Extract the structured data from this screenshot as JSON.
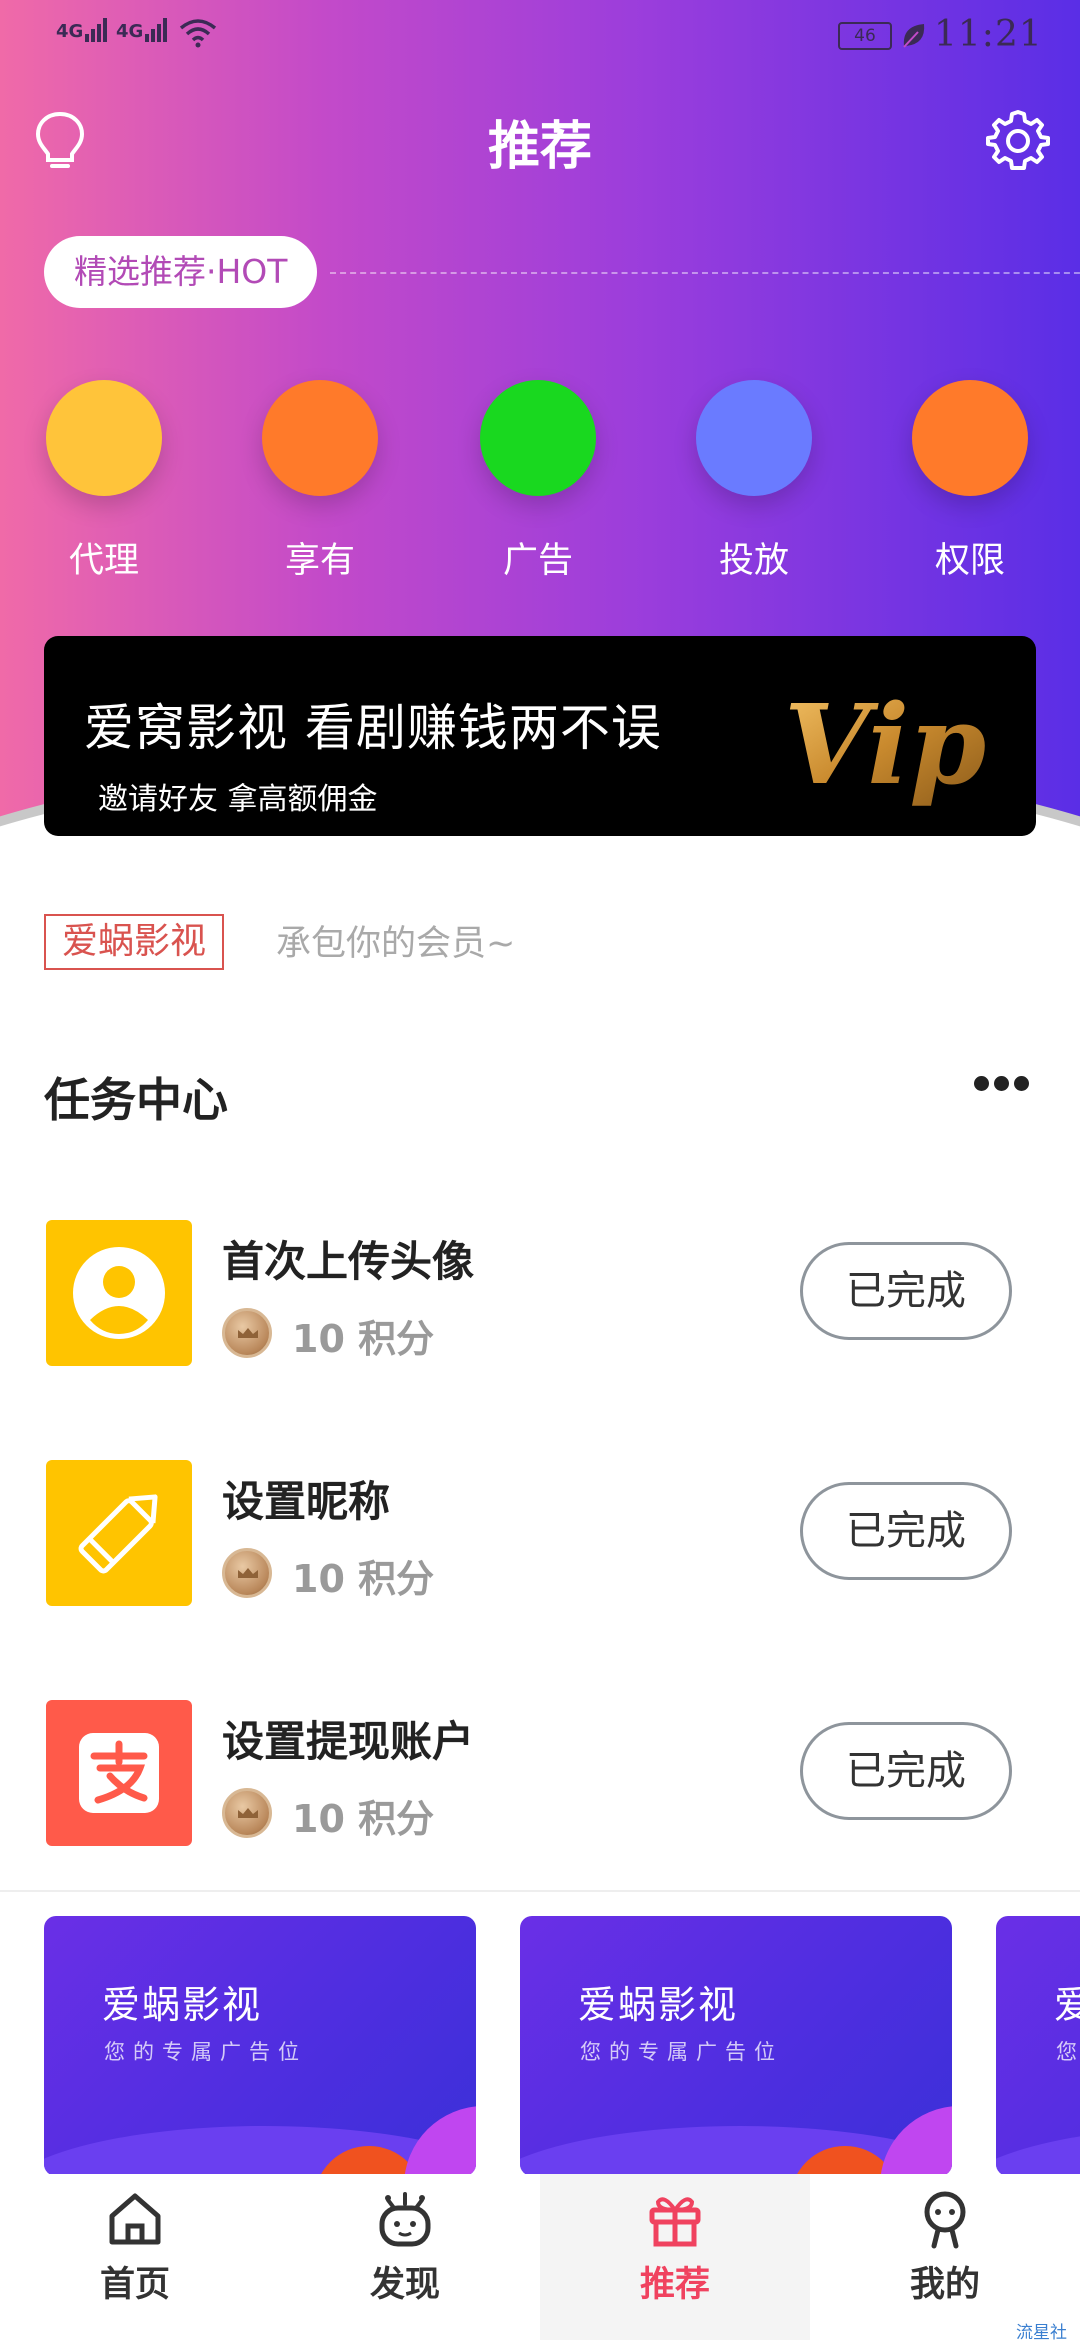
{
  "status_bar": {
    "signal1": "4G",
    "signal2": "4G",
    "battery": "46",
    "time": "11:21"
  },
  "header": {
    "title": "推荐"
  },
  "hot_pill": "精选推荐·HOT",
  "categories": [
    {
      "label": "代理",
      "color": "#ffc43a"
    },
    {
      "label": "享有",
      "color": "#ff7a2a"
    },
    {
      "label": "广告",
      "color": "#19d81f"
    },
    {
      "label": "投放",
      "color": "#6a7bff"
    },
    {
      "label": "权限",
      "color": "#ff7a2a"
    }
  ],
  "banner": {
    "title": "爱窝影视  看剧赚钱两不误",
    "subtitle": "邀请好友  拿高额佣金",
    "badge": "Vip"
  },
  "brand": {
    "tag": "爱蜗影视",
    "slogan": "承包你的会员~"
  },
  "tasks": {
    "title": "任务中心",
    "items": [
      {
        "title": "首次上传头像",
        "points": "10 积分",
        "button": "已完成",
        "icon": "avatar-icon",
        "color": "#ffc400"
      },
      {
        "title": "设置昵称",
        "points": "10 积分",
        "button": "已完成",
        "icon": "pencil-icon",
        "color": "#ffc400"
      },
      {
        "title": "设置提现账户",
        "points": "10 积分",
        "button": "已完成",
        "icon": "alipay-icon",
        "color": "#ff5a4a"
      }
    ]
  },
  "ads": [
    {
      "title": "爱蜗影视",
      "subtitle": "您的专属广告位"
    },
    {
      "title": "爱蜗影视",
      "subtitle": "您的专属广告位"
    },
    {
      "title": "爱",
      "subtitle": "您"
    }
  ],
  "tabbar": {
    "items": [
      {
        "label": "首页",
        "icon": "home-icon"
      },
      {
        "label": "发现",
        "icon": "robot-icon"
      },
      {
        "label": "推荐",
        "icon": "gift-icon",
        "active": true
      },
      {
        "label": "我的",
        "icon": "user-icon"
      }
    ],
    "active_color": "#f0425f"
  },
  "watermark": "流星社区"
}
